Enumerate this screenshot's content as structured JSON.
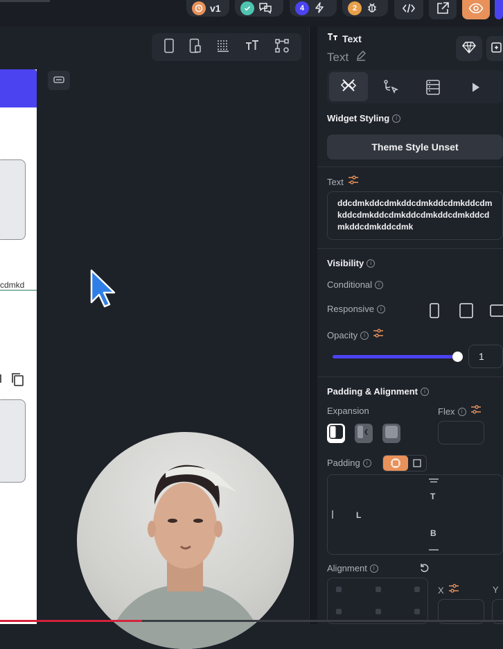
{
  "topbar": {
    "version_label": "v1",
    "tasks_count": "4",
    "bugs_count": "2"
  },
  "canvas": {
    "phone_text_fragment": "cdmkd"
  },
  "panel": {
    "widget_type_label": "Text",
    "widget_name": "Text",
    "widget_styling_title": "Widget Styling",
    "theme_button_label": "Theme Style Unset",
    "text_label": "Text",
    "text_value": "ddcdmkddcdmkddcdmkddcdmkddcdmkddcdmkddcdmkddcdmkddcdmkddcdmkddcdmkddcdmk",
    "visibility_title": "Visibility",
    "conditional_label": "Conditional",
    "responsive_label": "Responsive",
    "opacity_label": "Opacity",
    "opacity_value": "1",
    "opacity_fraction": 1.0,
    "padding_alignment_title": "Padding & Alignment",
    "expansion_label": "Expansion",
    "flex_label": "Flex",
    "padding_label": "Padding",
    "pad_top": "T",
    "pad_left": "L",
    "pad_bottom": "B",
    "alignment_label": "Alignment",
    "x_label": "X",
    "y_label": "Y"
  },
  "colors": {
    "accent": "#4c43f0",
    "orange": "#e8915a",
    "panel_bg": "#1e2229"
  },
  "icons": [
    "timer-icon",
    "check-icon",
    "chat-icon",
    "lightning-icon",
    "bug-icon",
    "code-icon",
    "external-link-icon",
    "eye-icon",
    "diamond-icon",
    "add-widget-icon",
    "edit-icon",
    "tools-icon",
    "flow-icon",
    "database-icon",
    "play-icon",
    "phone-icon",
    "tablet-icon",
    "desktop-icon",
    "info-icon",
    "copy-icon",
    "cursor-icon"
  ]
}
